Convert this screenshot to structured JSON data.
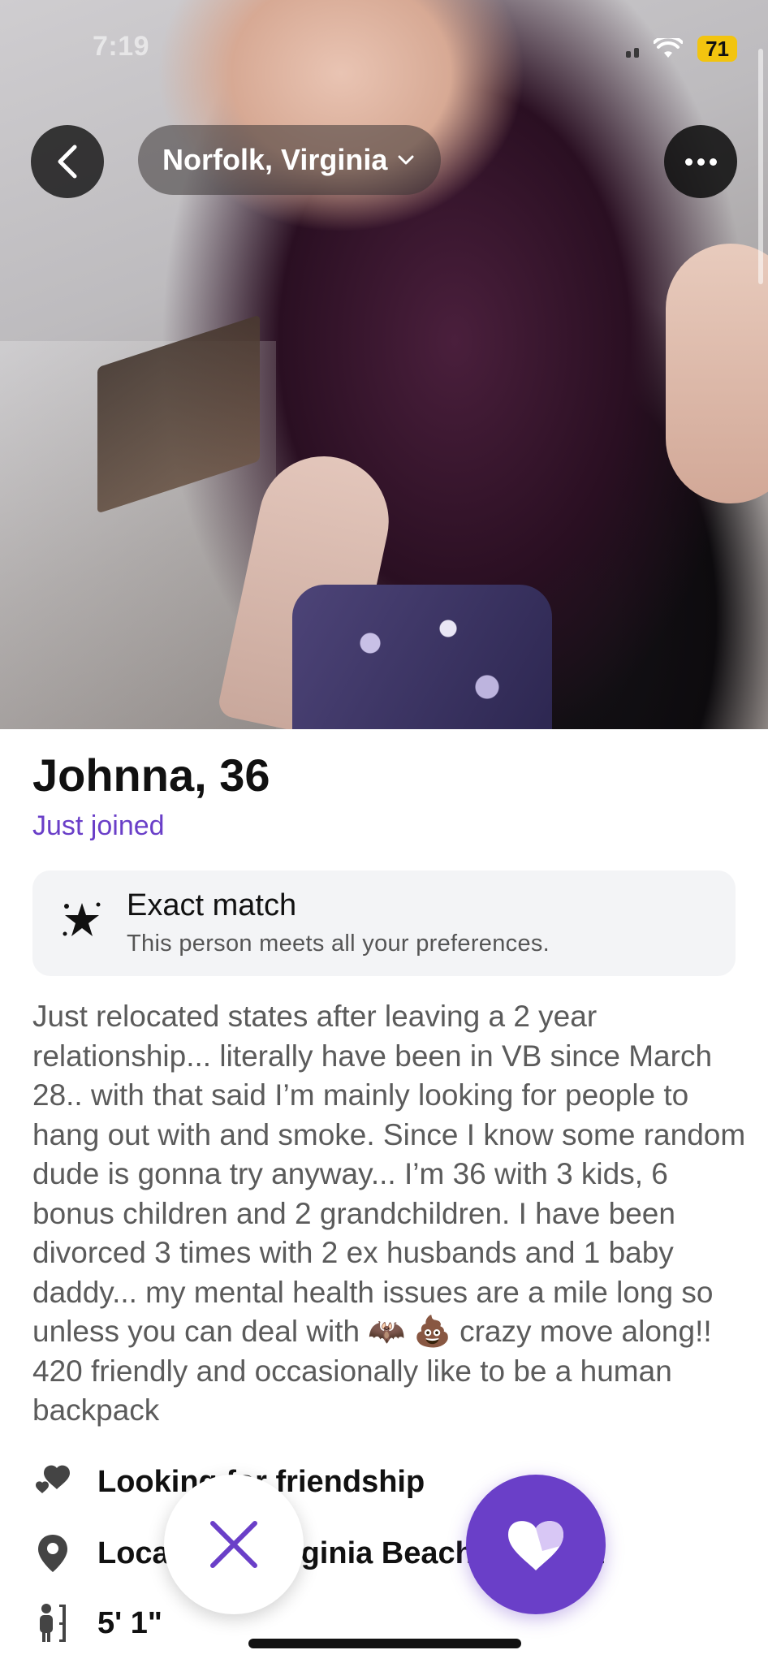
{
  "status_bar": {
    "time": "7:19",
    "battery": "71"
  },
  "header": {
    "location": "Norfolk, Virginia",
    "back_icon": "chevron-left-icon",
    "more_icon": "ellipsis-icon",
    "location_chevron_icon": "chevron-down-icon"
  },
  "profile": {
    "name_age": "Johnna, 36",
    "status": "Just joined",
    "match": {
      "title": "Exact match",
      "subtitle": "This person meets all your preferences.",
      "icon": "star-sparkle-icon"
    },
    "bio": "Just relocated states after leaving a 2 year relationship... literally have been in VB since March 28.. with that said I’m mainly looking for people to hang out with and smoke. Since I know some random dude is gonna try anyway... I’m 36 with 3 kids, 6 bonus children and 2 grandchildren. I have been divorced 3 times with 2 ex husbands and 1 baby daddy... my mental health issues are a mile long so unless you can deal with 🦇 💩 crazy move along!! 420 friendly and occasionally like to be a human backpack",
    "details": {
      "looking_for": "Looking for friendship",
      "location": "Located in Virginia Beach, Virginia",
      "height": "5' 1\""
    }
  },
  "actions": {
    "pass_icon": "close-icon",
    "like_icon": "heart-icon"
  },
  "colors": {
    "accent": "#6a3fc8",
    "battery": "#f2c40f",
    "card_bg": "#f3f4f6"
  }
}
